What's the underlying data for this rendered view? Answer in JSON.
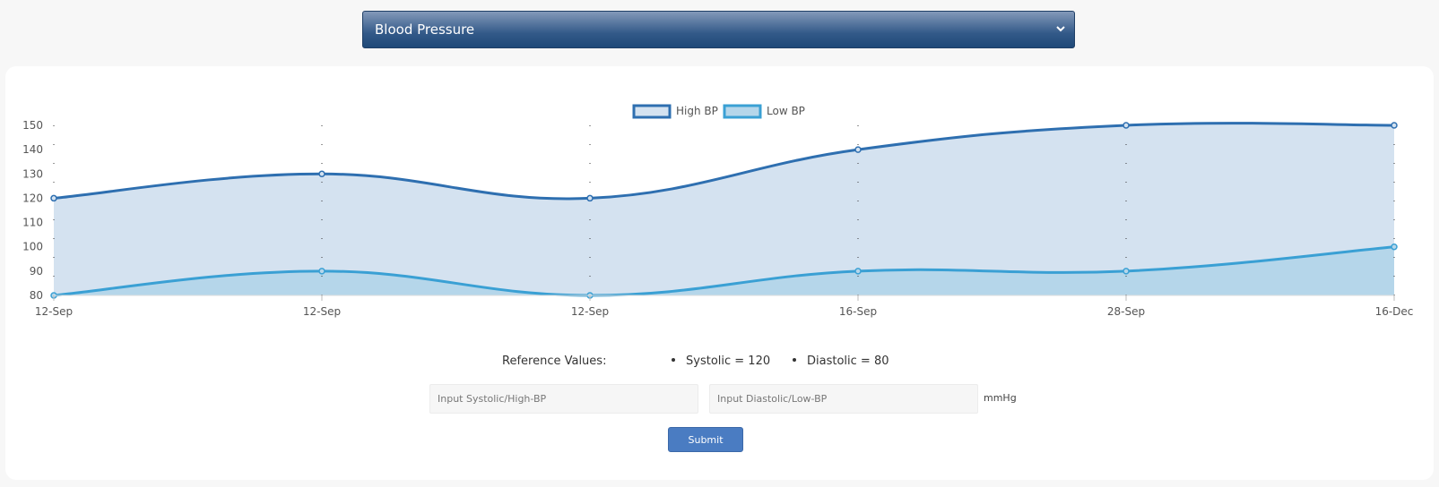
{
  "selector": {
    "selected": "Blood Pressure"
  },
  "chart_data": {
    "type": "area",
    "categories": [
      "12-Sep",
      "12-Sep",
      "12-Sep",
      "16-Sep",
      "28-Sep",
      "16-Dec"
    ],
    "series": [
      {
        "name": "High BP",
        "values": [
          120,
          130,
          120,
          140,
          150,
          150
        ],
        "color": "#2e6fb0",
        "fill": "#d4e2f0"
      },
      {
        "name": "Low BP",
        "values": [
          80,
          90,
          80,
          90,
          90,
          100
        ],
        "color": "#3aa0d4",
        "fill": "#b5d6ea"
      }
    ],
    "ylim": [
      80,
      150
    ],
    "yticks": [
      80,
      90,
      100,
      110,
      120,
      130,
      140,
      150
    ],
    "title": "",
    "xlabel": "",
    "ylabel": "",
    "legend_position": "top-center",
    "grid": "dotted vertical"
  },
  "reference": {
    "label": "Reference Values:",
    "items": [
      "Systolic = 120",
      "Diastolic = 80"
    ]
  },
  "form": {
    "systolic_placeholder": "Input Systolic/High-BP",
    "diastolic_placeholder": "Input Diastolic/Low-BP",
    "unit": "mmHg",
    "submit_label": "Submit"
  }
}
